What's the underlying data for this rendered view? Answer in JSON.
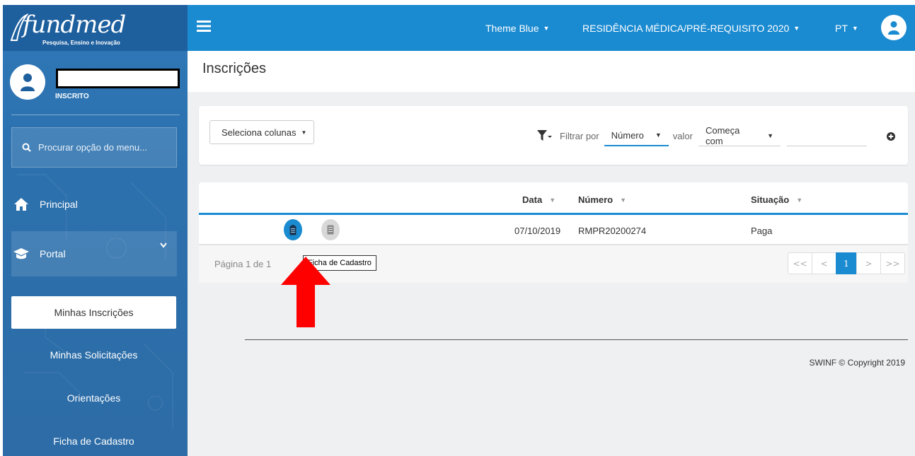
{
  "logo": {
    "brand": "fundmed",
    "tagline": "Pesquisa, Ensino e Inovação"
  },
  "user": {
    "role": "INSCRITO"
  },
  "sidebar": {
    "search_placeholder": "Procurar opção do menu...",
    "items": [
      {
        "label": "Principal",
        "icon": "home-icon"
      },
      {
        "label": "Portal",
        "icon": "graduation-cap-icon"
      }
    ],
    "subitems": [
      {
        "label": "Minhas Inscrições",
        "active": true
      },
      {
        "label": "Minhas Solicitações"
      },
      {
        "label": "Orientações"
      },
      {
        "label": "Ficha de Cadastro"
      }
    ]
  },
  "topbar": {
    "theme": "Theme Blue",
    "process": "RESIDÊNCIA MÉDICA/PRÉ-REQUISITO 2020",
    "language": "PT"
  },
  "page": {
    "title": "Inscrições"
  },
  "filters": {
    "columns_button": "Seleciona colunas",
    "filter_by_label": "Filtrar por",
    "field": "Número",
    "value_label": "valor",
    "operator": "Começa com",
    "value": ""
  },
  "table": {
    "columns": [
      "Data",
      "Número",
      "Situação"
    ],
    "rows": [
      {
        "date": "07/10/2019",
        "number": "RMPR20200274",
        "status": "Paga"
      }
    ],
    "page_info": "Página 1 de 1",
    "tooltip": "Ficha de Cadastro",
    "pager": [
      "<<",
      "<",
      "1",
      ">",
      ">>"
    ]
  },
  "footer": {
    "copyright": "SWINF © Copyright 2019"
  },
  "colors": {
    "primary": "#1b8bd1",
    "sidebar": "#2d70ab",
    "arrow": "#ff0000"
  }
}
